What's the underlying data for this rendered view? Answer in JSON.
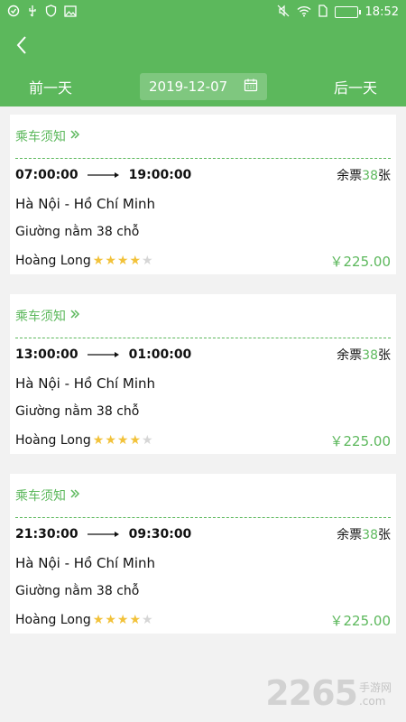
{
  "status": {
    "time": "18:52",
    "left_icons": [
      "check-circle-icon",
      "usb-icon",
      "shield-icon",
      "image-icon"
    ],
    "right_icons": [
      "mute-icon",
      "wifi-icon",
      "sim-icon",
      "battery-icon"
    ]
  },
  "nav": {
    "prev_label": "前一天",
    "next_label": "后一天",
    "date": "2019-12-07"
  },
  "colors": {
    "accent": "#5cb85c",
    "star_on": "#f2c23a",
    "star_off": "#d6d6d6"
  },
  "trips": [
    {
      "notice_label": "乘车须知",
      "depart": "07:00:00",
      "arrive": "19:00:00",
      "tickets_prefix": "余票",
      "tickets_count": "38",
      "tickets_suffix": "张",
      "route": "Hà Nội - Hồ Chí Minh",
      "seat": "Giường nằm 38 chỗ",
      "operator": "Hoàng Long",
      "rating": 4,
      "rating_max": 5,
      "price": "￥225.00"
    },
    {
      "notice_label": "乘车须知",
      "depart": "13:00:00",
      "arrive": "01:00:00",
      "tickets_prefix": "余票",
      "tickets_count": "38",
      "tickets_suffix": "张",
      "route": "Hà Nội - Hồ Chí Minh",
      "seat": "Giường nằm 38 chỗ",
      "operator": "Hoàng Long",
      "rating": 4,
      "rating_max": 5,
      "price": "￥225.00"
    },
    {
      "notice_label": "乘车须知",
      "depart": "21:30:00",
      "arrive": "09:30:00",
      "tickets_prefix": "余票",
      "tickets_count": "38",
      "tickets_suffix": "张",
      "route": "Hà Nội - Hồ Chí Minh",
      "seat": "Giường nằm 38 chỗ",
      "operator": "Hoàng Long",
      "rating": 4,
      "rating_max": 5,
      "price": "￥225.00"
    }
  ],
  "watermark": {
    "number": "2265",
    "text_top": "手游网",
    "text_bottom": ".com"
  }
}
